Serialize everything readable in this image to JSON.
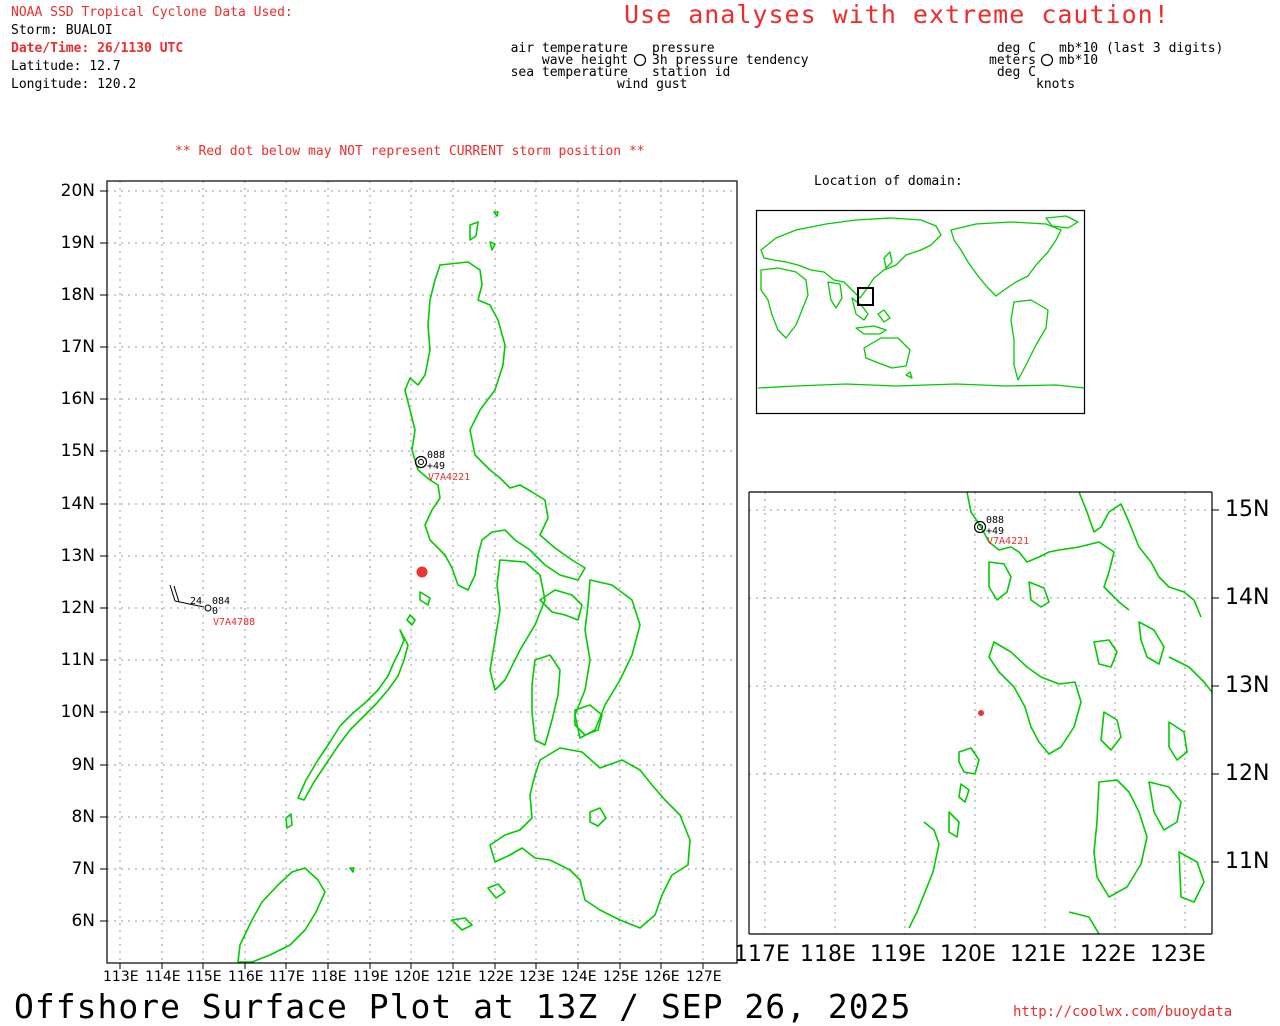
{
  "header": {
    "data_title": "NOAA SSD Tropical Cyclone Data Used:",
    "storm": "Storm: BUALOI",
    "datetime": "Date/Time: 26/1130 UTC",
    "latitude": "Latitude: 12.7",
    "longitude": "Longitude: 120.2",
    "caution": "Use analyses with extreme caution!"
  },
  "legend": {
    "left": {
      "air_temperature": "air temperature",
      "wave_height": "wave height",
      "sea_temperature": "sea temperature",
      "pressure": "pressure",
      "pressure_tendency": "3h pressure tendency",
      "station_id": "station id",
      "wind_gust": "wind gust"
    },
    "right": {
      "deg_c_1": "deg C",
      "meters": "meters",
      "deg_c_2": "deg C",
      "mb_last3": "mb*10 (last 3 digits)",
      "mb": "mb*10",
      "knots": "knots"
    }
  },
  "notice": "** Red dot below may NOT represent CURRENT storm position **",
  "main_map": {
    "lat_labels": [
      "20N",
      "19N",
      "18N",
      "17N",
      "16N",
      "15N",
      "14N",
      "13N",
      "12N",
      "11N",
      "10N",
      "9N",
      "8N",
      "7N",
      "6N"
    ],
    "lon_labels": [
      "113E",
      "114E",
      "115E",
      "116E",
      "117E",
      "118E",
      "119E",
      "120E",
      "121E",
      "122E",
      "123E",
      "124E",
      "125E",
      "126E",
      "127E"
    ],
    "stations": [
      {
        "id": "V7A4221",
        "pressure": "088",
        "tendency": "+49"
      },
      {
        "id": "V7A4788",
        "air_temp": "24",
        "pressure": "084",
        "wind_gust": "0"
      }
    ],
    "storm_position": {
      "lat": 12.7,
      "lon": 120.2,
      "color": "#ee3333"
    }
  },
  "inset_world": {
    "title": "Location of domain:"
  },
  "zoom_map": {
    "lat_labels": [
      "15N",
      "14N",
      "13N",
      "12N",
      "11N"
    ],
    "lon_labels": [
      "117E",
      "118E",
      "119E",
      "120E",
      "121E",
      "122E",
      "123E"
    ],
    "station": {
      "id": "V7A4221",
      "pressure": "088",
      "tendency": "+49"
    }
  },
  "footer": {
    "title": "Offshore Surface Plot at 13Z / SEP 26, 2025",
    "url": "http://coolwx.com/buoydata"
  },
  "colors": {
    "coast": "#00cc00",
    "red": "#ee2c2c",
    "frame": "#000000"
  }
}
